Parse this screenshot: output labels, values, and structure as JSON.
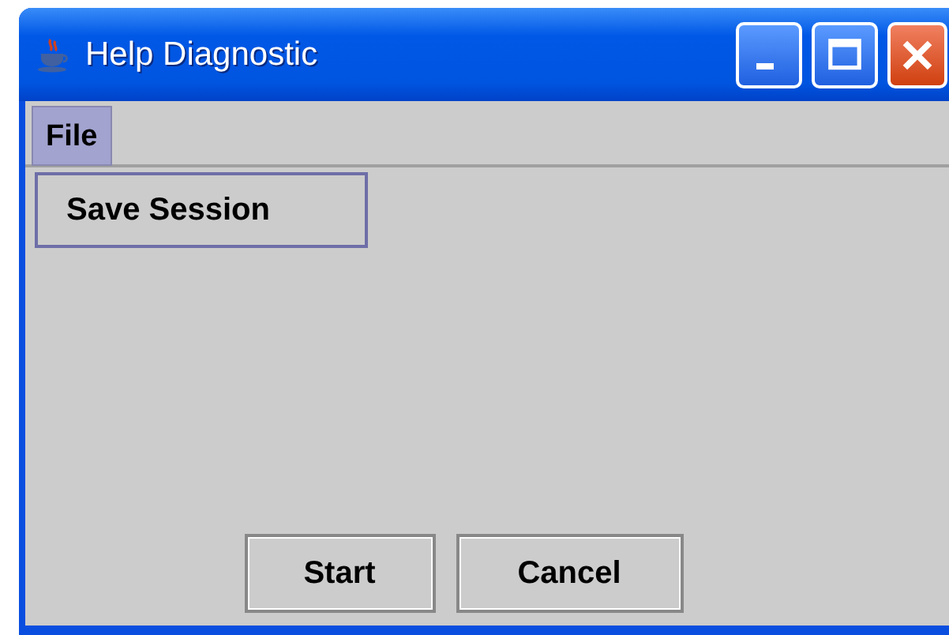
{
  "window": {
    "title": "Help Diagnostic"
  },
  "menu_bar": [
    {
      "label": "File",
      "selected": true
    }
  ],
  "menu_popup": {
    "items": [
      "Save Session"
    ]
  },
  "buttons": [
    "Start",
    "Cancel"
  ]
}
